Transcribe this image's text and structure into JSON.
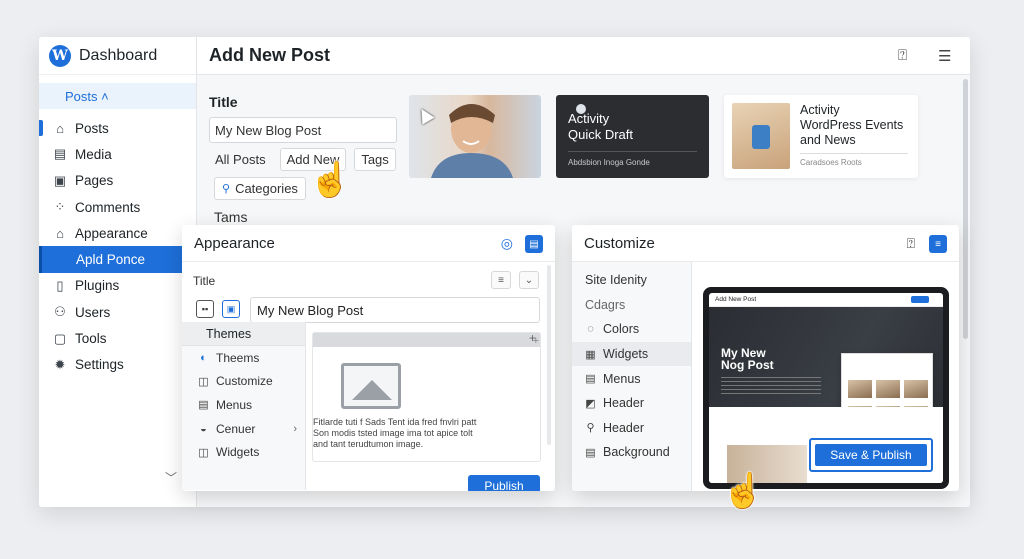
{
  "app": {
    "brand": "Dashboard",
    "page_title": "Add New Post"
  },
  "sidebar": {
    "flyout": "Posts ˄",
    "items": [
      {
        "label": "Posts",
        "icon": "pin-icon",
        "glyph": "⌂"
      },
      {
        "label": "Media",
        "icon": "media-icon",
        "glyph": "▤"
      },
      {
        "label": "Pages",
        "icon": "pages-icon",
        "glyph": "▣"
      },
      {
        "label": "Comments",
        "icon": "comments-icon",
        "glyph": "⁘"
      },
      {
        "label": "Appearance",
        "icon": "appearance-icon",
        "glyph": "⌂"
      },
      {
        "label": "Apld Ponce",
        "icon": "",
        "glyph": ""
      },
      {
        "label": "Plugins",
        "icon": "plugins-icon",
        "glyph": "▯"
      },
      {
        "label": "Users",
        "icon": "users-icon",
        "glyph": "⚇"
      },
      {
        "label": "Tools",
        "icon": "tools-icon",
        "glyph": "▢"
      },
      {
        "label": "Settings",
        "icon": "settings-icon",
        "glyph": "✹"
      }
    ]
  },
  "post_form": {
    "title_label": "Title",
    "title_value": "My New Blog Post",
    "links": {
      "all_posts": "All Posts",
      "add_new": "Add New",
      "tags": "Tags",
      "categories": "Categories"
    },
    "tams": "Tams"
  },
  "cards": {
    "dark": {
      "title": "Activity\nQuick Draft",
      "sub": "Abdsbion Inoga Gonde"
    },
    "light": {
      "title": "Activity\nWordPress Events\nand News",
      "sub": "Caradsoes Roots"
    }
  },
  "appearance_panel": {
    "title": "Appearance",
    "title_label": "Title",
    "title_value": "My New Blog Post",
    "dropdown_head": "Themes",
    "dropdown_items": [
      {
        "label": "Theems",
        "icon": "themes-icon",
        "glyph": "◐"
      },
      {
        "label": "Customize",
        "icon": "customize-icon",
        "glyph": "◫"
      },
      {
        "label": "Menus",
        "icon": "menus-icon",
        "glyph": "▤"
      },
      {
        "label": "Cenuer",
        "icon": "cenuer-icon",
        "glyph": "◒"
      },
      {
        "label": "Widgets",
        "icon": "widgets-icon",
        "glyph": "◫"
      }
    ],
    "preview_text": "Fitlarde tuti f Sads Tent ida fred fnvlri patt\nSon modis tsted image ima tot apice tolt\nand tant terudtumon image.",
    "publish": "Publish"
  },
  "customize_panel": {
    "title": "Customize",
    "items": [
      {
        "label": "Site Idenity",
        "glyph": ""
      },
      {
        "label": "Cdagrs",
        "glyph": ""
      },
      {
        "label": "Colors",
        "glyph": "◌"
      },
      {
        "label": "Widgets",
        "glyph": "▦"
      },
      {
        "label": "Menus",
        "glyph": "▤"
      },
      {
        "label": "Header",
        "glyph": "◩"
      },
      {
        "label": "Header",
        "glyph": "⚲"
      },
      {
        "label": "Background",
        "glyph": "▤"
      }
    ],
    "preview": {
      "bar_title": "Add New Post",
      "hero_title": "My New\nNog Post",
      "save_publish": "Save & Publish"
    }
  },
  "colors": {
    "accent": "#1e6fd9",
    "dark_card": "#2b2d30"
  }
}
